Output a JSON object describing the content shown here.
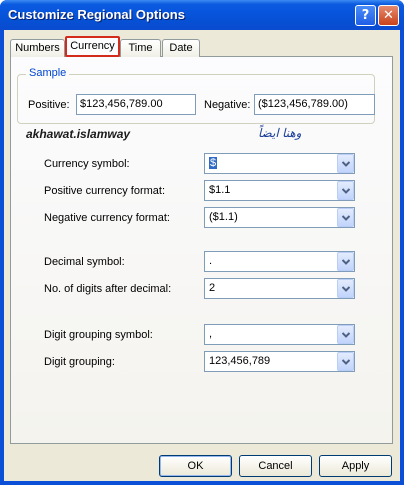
{
  "window": {
    "title": "Customize Regional Options",
    "help_glyph": "?",
    "close_glyph": "✕"
  },
  "tabs": [
    {
      "label": "Numbers",
      "active": false
    },
    {
      "label": "Currency",
      "active": true
    },
    {
      "label": "Time",
      "active": false
    },
    {
      "label": "Date",
      "active": false
    }
  ],
  "sample": {
    "title": "Sample",
    "positive_label": "Positive:",
    "positive_value": "$123,456,789.00",
    "negative_label": "Negative:",
    "negative_value": "($123,456,789.00)"
  },
  "watermark": {
    "left": "akhawat.islamway",
    "right": "وهنا ايضاً"
  },
  "fields": {
    "currency_symbol": {
      "label": "Currency symbol:",
      "value": "$"
    },
    "positive_format": {
      "label": "Positive currency format:",
      "value": "$1.1"
    },
    "negative_format": {
      "label": "Negative currency format:",
      "value": "($1.1)"
    },
    "decimal_symbol": {
      "label": "Decimal symbol:",
      "value": "."
    },
    "digits_after_decimal": {
      "label": "No. of digits after decimal:",
      "value": "2"
    },
    "grouping_symbol": {
      "label": "Digit grouping symbol:",
      "value": ","
    },
    "digit_grouping": {
      "label": "Digit grouping:",
      "value": "123,456,789"
    }
  },
  "buttons": {
    "ok": "OK",
    "cancel": "Cancel",
    "apply": "Apply"
  },
  "colors": {
    "titlebar": "#0855dd",
    "dialog_face": "#ece9d8",
    "group_title": "#0046d5",
    "active_tab_highlight": "#d42a1c",
    "selection": "#316ac5"
  }
}
